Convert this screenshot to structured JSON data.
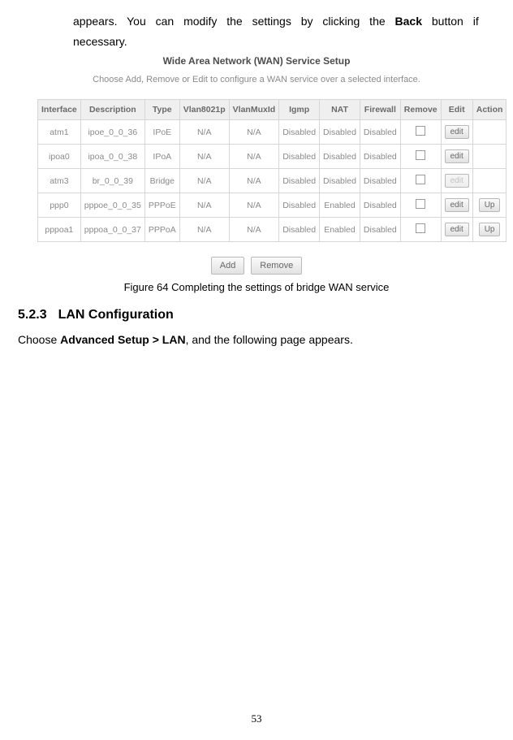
{
  "intro": {
    "line1_pre": "appears. You can modify the settings by clicking the ",
    "back": "Back",
    "line1_post": " button if",
    "line2": "necessary."
  },
  "screenshot": {
    "title": "Wide Area Network (WAN) Service Setup",
    "subtitle": "Choose Add, Remove or Edit to configure a WAN service over a selected interface.",
    "headers": [
      "Interface",
      "Description",
      "Type",
      "Vlan8021p",
      "VlanMuxId",
      "Igmp",
      "NAT",
      "Firewall",
      "Remove",
      "Edit",
      "Action"
    ],
    "rows": [
      {
        "c": [
          "atm1",
          "ipoe_0_0_36",
          "IPoE",
          "N/A",
          "N/A",
          "Disabled",
          "Disabled",
          "Disabled"
        ],
        "edit": "edit",
        "editDisabled": false,
        "up": ""
      },
      {
        "c": [
          "ipoa0",
          "ipoa_0_0_38",
          "IPoA",
          "N/A",
          "N/A",
          "Disabled",
          "Disabled",
          "Disabled"
        ],
        "edit": "edit",
        "editDisabled": false,
        "up": ""
      },
      {
        "c": [
          "atm3",
          "br_0_0_39",
          "Bridge",
          "N/A",
          "N/A",
          "Disabled",
          "Disabled",
          "Disabled"
        ],
        "edit": "edit",
        "editDisabled": true,
        "up": ""
      },
      {
        "c": [
          "ppp0",
          "pppoe_0_0_35",
          "PPPoE",
          "N/A",
          "N/A",
          "Disabled",
          "Enabled",
          "Disabled"
        ],
        "edit": "edit",
        "editDisabled": false,
        "up": "Up"
      },
      {
        "c": [
          "pppoa1",
          "pppoa_0_0_37",
          "PPPoA",
          "N/A",
          "N/A",
          "Disabled",
          "Enabled",
          "Disabled"
        ],
        "edit": "edit",
        "editDisabled": false,
        "up": "Up"
      }
    ],
    "add": "Add",
    "remove": "Remove"
  },
  "figcaption": "Figure 64 Completing the settings of bridge WAN service",
  "section": {
    "num": "5.2.3",
    "title": "LAN Configuration"
  },
  "paragraph": {
    "pre": "Choose ",
    "bold": "Advanced Setup > LAN",
    "post": ", and the following page appears."
  },
  "page_number": "53"
}
